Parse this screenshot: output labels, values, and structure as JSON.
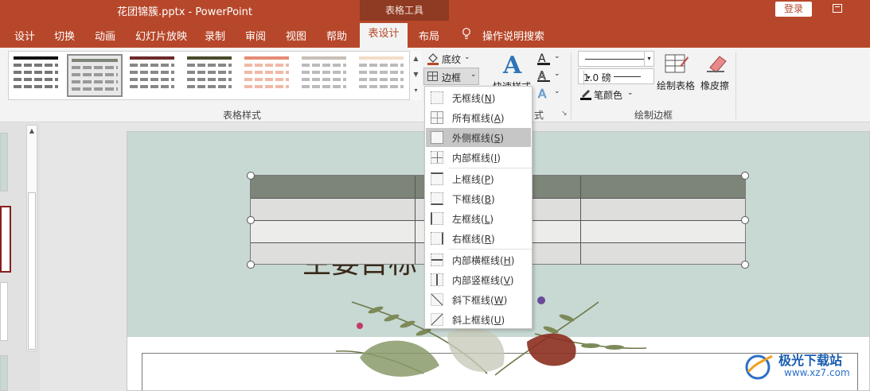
{
  "titlebar": {
    "title": "花团锦簇.pptx  -  PowerPoint",
    "context_tab_group": "表格工具",
    "login_label": "登录"
  },
  "tabs": {
    "items": [
      "设计",
      "切换",
      "动画",
      "幻灯片放映",
      "录制",
      "审阅",
      "视图",
      "帮助"
    ],
    "active": "表设计",
    "layout": "布局",
    "tell_me": "操作说明搜索"
  },
  "ribbon": {
    "table_styles_label": "表格样式",
    "shading_label": "底纹",
    "borders_label": "边框",
    "quick_styles_label": "快速样式",
    "wordart_group_tail": "式",
    "pen_weight": "1.0 磅",
    "pen_color_label": "笔颜色",
    "draw_table_label": "绘制表格",
    "eraser_label": "橡皮擦",
    "draw_borders_label": "绘制边框"
  },
  "border_menu": {
    "items": [
      {
        "label": "无框线",
        "key": "N"
      },
      {
        "label": "所有框线",
        "key": "A"
      },
      {
        "label": "外侧框线",
        "key": "S",
        "selected": true
      },
      {
        "label": "内部框线",
        "key": "I"
      },
      {
        "label": "上框线",
        "key": "P"
      },
      {
        "label": "下框线",
        "key": "B"
      },
      {
        "label": "左框线",
        "key": "L"
      },
      {
        "label": "右框线",
        "key": "R"
      },
      {
        "label": "内部横框线",
        "key": "H"
      },
      {
        "label": "内部竖框线",
        "key": "V"
      },
      {
        "label": "斜下框线",
        "key": "W"
      },
      {
        "label": "斜上框线",
        "key": "U"
      }
    ]
  },
  "slide": {
    "title_text": "主要目标"
  },
  "watermark": {
    "text": "极光下载站",
    "url": "www.xz7.com"
  },
  "colors": {
    "accent": "#b7472a",
    "header_row": "#7d8478",
    "row_light": "#dededc",
    "row_white": "#ececea",
    "selected_menu": "#c6c6c6"
  }
}
